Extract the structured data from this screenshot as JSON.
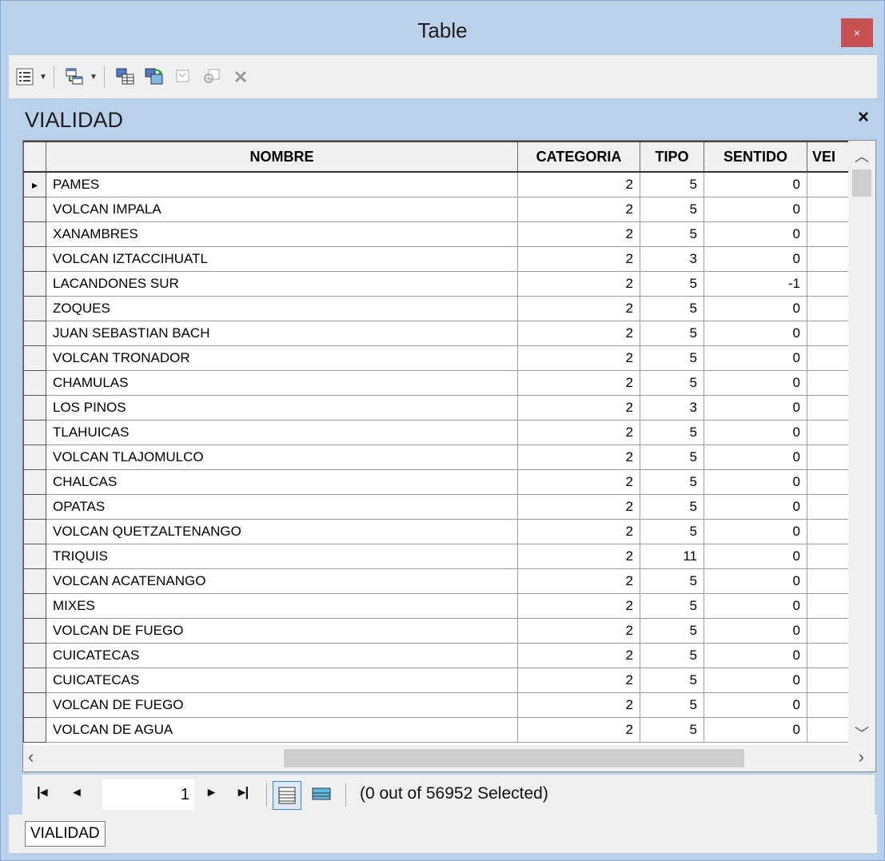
{
  "window": {
    "title": "Table",
    "close_label": "×"
  },
  "toolbar": {
    "buttons": [
      "table-options-icon",
      "related-tables-icon",
      "select-by-attributes-icon",
      "switch-selection-icon",
      "clear-selection-icon",
      "zoom-to-selected-icon",
      "delete-selected-icon"
    ]
  },
  "panel": {
    "title": "VIALIDAD",
    "close_label": "×"
  },
  "table": {
    "columns": [
      "NOMBRE",
      "CATEGORIA",
      "TIPO",
      "SENTIDO",
      "VEI"
    ],
    "current_marker": "▸",
    "rows": [
      [
        "PAMES",
        "2",
        "5",
        "0"
      ],
      [
        "VOLCAN IMPALA",
        "2",
        "5",
        "0"
      ],
      [
        "XANAMBRES",
        "2",
        "5",
        "0"
      ],
      [
        "VOLCAN IZTACCIHUATL",
        "2",
        "3",
        "0"
      ],
      [
        "LACANDONES SUR",
        "2",
        "5",
        "-1"
      ],
      [
        "ZOQUES",
        "2",
        "5",
        "0"
      ],
      [
        "JUAN SEBASTIAN BACH",
        "2",
        "5",
        "0"
      ],
      [
        "VOLCAN TRONADOR",
        "2",
        "5",
        "0"
      ],
      [
        "CHAMULAS",
        "2",
        "5",
        "0"
      ],
      [
        "LOS PINOS",
        "2",
        "3",
        "0"
      ],
      [
        "TLAHUICAS",
        "2",
        "5",
        "0"
      ],
      [
        "VOLCAN TLAJOMULCO",
        "2",
        "5",
        "0"
      ],
      [
        "CHALCAS",
        "2",
        "5",
        "0"
      ],
      [
        "OPATAS",
        "2",
        "5",
        "0"
      ],
      [
        "VOLCAN QUETZALTENANGO",
        "2",
        "5",
        "0"
      ],
      [
        "TRIQUIS",
        "2",
        "11",
        "0"
      ],
      [
        "VOLCAN ACATENANGO",
        "2",
        "5",
        "0"
      ],
      [
        "MIXES",
        "2",
        "5",
        "0"
      ],
      [
        "VOLCAN  DE FUEGO",
        "2",
        "5",
        "0"
      ],
      [
        "CUICATECAS",
        "2",
        "5",
        "0"
      ],
      [
        "CUICATECAS",
        "2",
        "5",
        "0"
      ],
      [
        "VOLCAN  DE FUEGO",
        "2",
        "5",
        "0"
      ],
      [
        "VOLCAN  DE AGUA",
        "2",
        "5",
        "0"
      ]
    ]
  },
  "navigation": {
    "page": "1",
    "status": "(0 out of 56952 Selected)"
  },
  "tabs": [
    {
      "label": "VIALIDAD"
    }
  ]
}
